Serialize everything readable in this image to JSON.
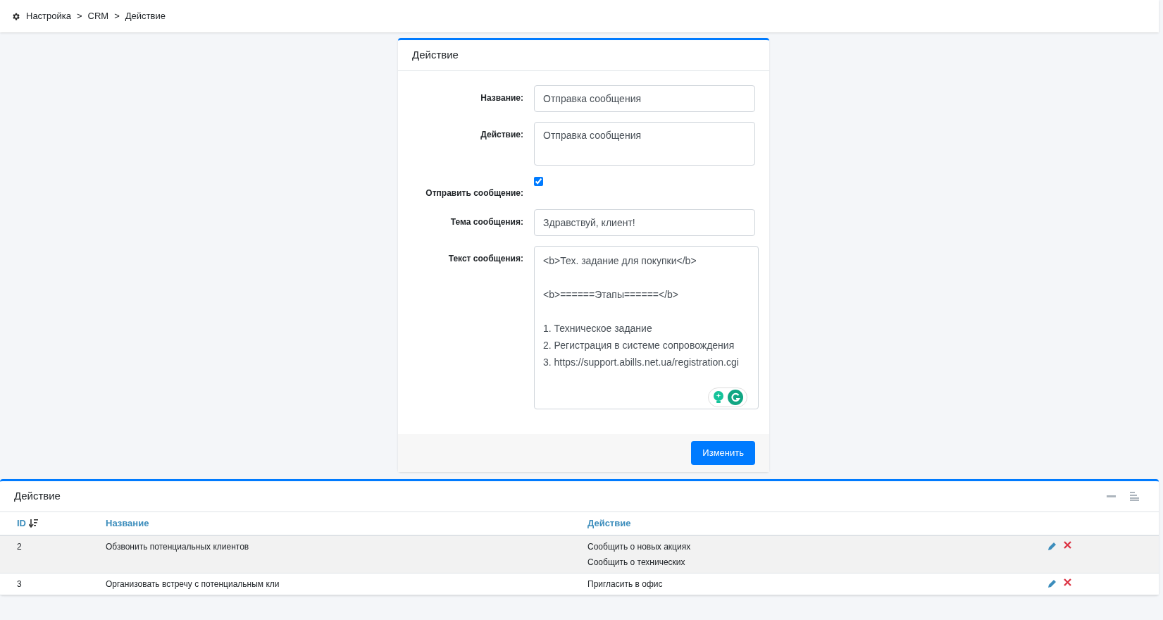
{
  "breadcrumb": [
    "Настройка",
    "CRM",
    "Действие"
  ],
  "breadcrumb_separator": ">",
  "form": {
    "title": "Действие",
    "fields": [
      {
        "kind": "input",
        "label": "Название:",
        "value": "Отправка сообщения"
      },
      {
        "kind": "textarea",
        "label": "Действие:",
        "value": "Отправка сообщения"
      },
      {
        "kind": "checkbox",
        "label": "Отправить сообщение:",
        "checked": true
      },
      {
        "kind": "input",
        "label": "Тема сообщения:",
        "value": "Здравствуй, клиент!"
      },
      {
        "kind": "editor",
        "label": "Текст сообщения:",
        "value": "<b>Тех. задание для покупки</b>\n\n<b>======Этапы======</b>\n\n1. Техническое задание\n2. Регистрация в системе сопровождения\n3. https://support.abills.net.ua/registration.cgi"
      }
    ],
    "submit": "Изменить"
  },
  "table": {
    "title": "Действие",
    "columns": [
      "ID",
      "Название",
      "Действие"
    ],
    "rows": [
      {
        "id": "2",
        "name": "Обзвонить потенциальных клиентов",
        "actions": [
          "Сообщить о новых акциях",
          "Сообщить о технических"
        ],
        "highlighted": true
      },
      {
        "id": "3",
        "name": "Организовать встречу с потенциальным кли",
        "actions": [
          "Пригласить в офис"
        ],
        "highlighted": false
      }
    ]
  }
}
